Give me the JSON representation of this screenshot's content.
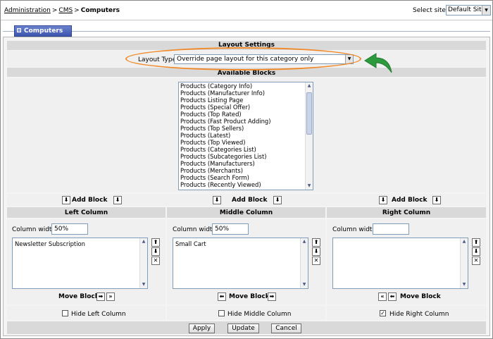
{
  "breadcrumb": {
    "items": [
      "Administration",
      "CMS"
    ],
    "current": "Computers",
    "separator": ">"
  },
  "site_selector": {
    "label": "Select site:",
    "value": "Default Site"
  },
  "tab": {
    "label": "Computers"
  },
  "layout_settings": {
    "title": "Layout Settings",
    "type_label": "Layout Type",
    "type_value": "Override page layout for this category only"
  },
  "available_blocks": {
    "title": "Available Blocks",
    "items": [
      "Products (Category Info)",
      "Products (Manufacturer Info)",
      "Products Listing Page",
      "Products (Special Offer)",
      "Products (Top Rated)",
      "Products (Fast Product Adding)",
      "Products (Top Sellers)",
      "Products (Latest)",
      "Products (Top Viewed)",
      "Products (Categories List)",
      "Products (Subcategories List)",
      "Products (Manufacturers)",
      "Products (Merchants)",
      "Products (Search Form)",
      "Products (Recently Viewed)"
    ]
  },
  "add_block_label": "Add Block",
  "move_block_label": "Move Block",
  "column_width_label": "Column width",
  "columns": {
    "left": {
      "title": "Left Column",
      "width": "50%",
      "blocks": [
        "Newsletter Subscription"
      ],
      "hide_label": "Hide Left Column",
      "hidden": false
    },
    "middle": {
      "title": "Middle Column",
      "width": "50%",
      "blocks": [
        "Small Cart"
      ],
      "hide_label": "Hide Middle Column",
      "hidden": false
    },
    "right": {
      "title": "Right Column",
      "width": "",
      "blocks": [],
      "hide_label": "Hide Right Column",
      "hidden": true
    }
  },
  "buttons": {
    "apply": "Apply",
    "update": "Update",
    "cancel": "Cancel"
  },
  "colors": {
    "tab": "#3c55ae",
    "highlight_ellipse": "#f08a2a",
    "arrow": "#2e9a3e",
    "band": "#d9d9d9"
  },
  "icons": {
    "arrow_down": "down-arrow-icon",
    "arrow_up": "up-arrow-icon",
    "remove": "close-icon"
  }
}
